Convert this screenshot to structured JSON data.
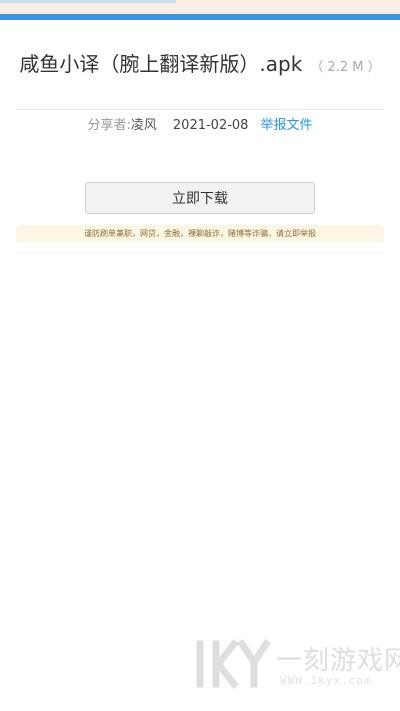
{
  "header": {
    "file_name": "咸鱼小译（腕上翻译新版）.apk",
    "file_size": "（ 2.2 M ）"
  },
  "meta": {
    "sharer_label": "分享者:",
    "sharer_name": "凌风",
    "date": "2021-02-08",
    "report_link": "举报文件"
  },
  "actions": {
    "download_label": "立即下载"
  },
  "warning": {
    "text": "谨防刷单兼职，网贷，金融，裸聊敲诈，赌博等诈骗，请立即举报"
  },
  "watermark": {
    "logo_text": "1KY",
    "site_name": "一刻游戏网",
    "url": "WWW.1kyx.com"
  },
  "colors": {
    "accent_bar": "#3a95e0",
    "link": "#2196f3",
    "warning_bg": "#fdf6e3"
  }
}
